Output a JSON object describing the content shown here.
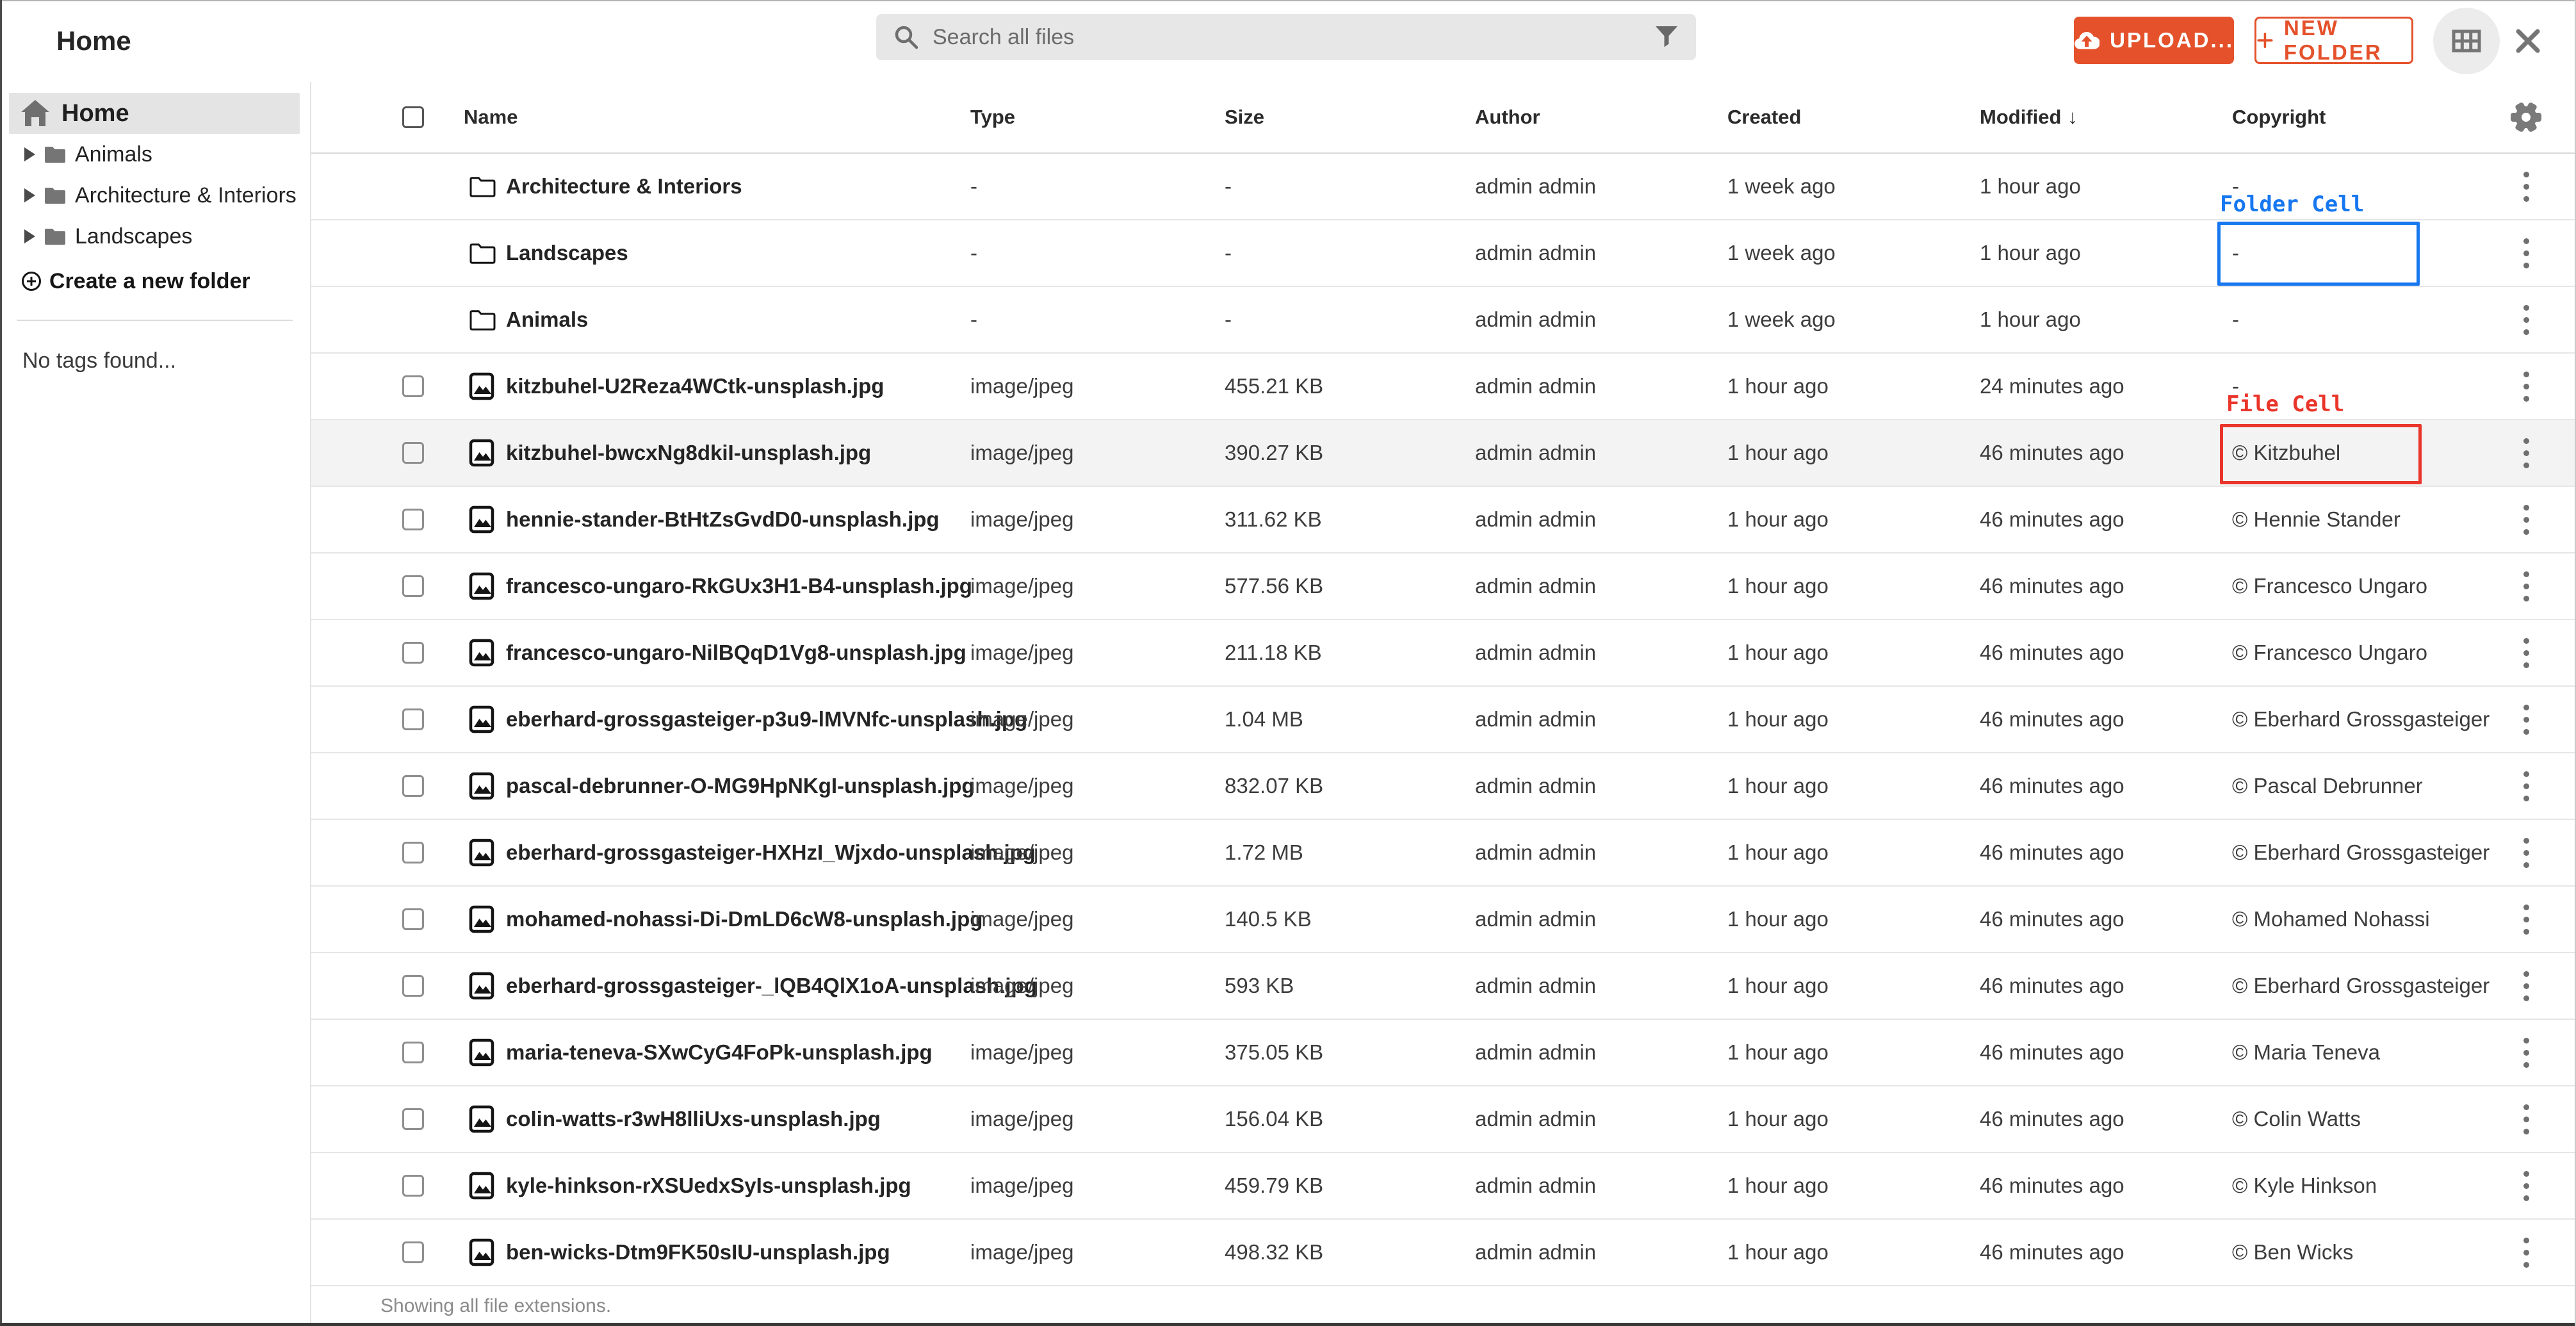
{
  "window": {
    "title": "Home"
  },
  "colors": {
    "accent_orange": "#e4512b",
    "annotation_blue": "#1677f0",
    "annotation_red": "#ea352b",
    "sidebar_selected_bg": "#e4e4e4",
    "row_highlight_bg": "#f3f3f3",
    "search_bg": "#e7e7e7"
  },
  "topbar": {
    "search_placeholder": "Search all files",
    "upload_label": "UPLOAD...",
    "new_folder_label": "NEW FOLDER",
    "icons": {
      "search": "magnifier",
      "filter": "funnel",
      "upload": "cloud-upload",
      "new_folder": "plus",
      "view_toggle": "grid",
      "close": "x"
    }
  },
  "sidebar": {
    "home_label": "Home",
    "home_icon": "house",
    "folders": [
      "Animals",
      "Architecture & Interiors",
      "Landscapes"
    ],
    "create_label": "Create a new folder",
    "create_icon": "circle-plus",
    "empty_tags": "No tags found..."
  },
  "table": {
    "headers": [
      "Name",
      "Type",
      "Size",
      "Author",
      "Created",
      "Modified",
      "Copyright"
    ],
    "sort": {
      "column": "Modified",
      "direction": "desc",
      "glyph": "↓"
    },
    "header_icons": {
      "settings": "gear",
      "select_all": "checkbox"
    },
    "row_menu_icon": "kebab",
    "rows": [
      {
        "kind": "folder",
        "name": "Architecture & Interiors",
        "type": "-",
        "size": "-",
        "author": "admin admin",
        "created": "1 week ago",
        "modified": "1 hour ago",
        "copyright": "-"
      },
      {
        "kind": "folder",
        "name": "Landscapes",
        "type": "-",
        "size": "-",
        "author": "admin admin",
        "created": "1 week ago",
        "modified": "1 hour ago",
        "copyright": "-",
        "annotation": "folder_cell"
      },
      {
        "kind": "folder",
        "name": "Animals",
        "type": "-",
        "size": "-",
        "author": "admin admin",
        "created": "1 week ago",
        "modified": "1 hour ago",
        "copyright": "-"
      },
      {
        "kind": "file",
        "name": "kitzbuhel-U2Reza4WCtk-unsplash.jpg",
        "type": "image/jpeg",
        "size": "455.21 KB",
        "author": "admin admin",
        "created": "1 hour ago",
        "modified": "24 minutes ago",
        "copyright": "-"
      },
      {
        "kind": "file",
        "name": "kitzbuhel-bwcxNg8dkiI-unsplash.jpg",
        "type": "image/jpeg",
        "size": "390.27 KB",
        "author": "admin admin",
        "created": "1 hour ago",
        "modified": "46 minutes ago",
        "copyright": "© Kitzbuhel",
        "highlighted": true,
        "annotation": "file_cell"
      },
      {
        "kind": "file",
        "name": "hennie-stander-BtHtZsGvdD0-unsplash.jpg",
        "type": "image/jpeg",
        "size": "311.62 KB",
        "author": "admin admin",
        "created": "1 hour ago",
        "modified": "46 minutes ago",
        "copyright": "© Hennie Stander"
      },
      {
        "kind": "file",
        "name": "francesco-ungaro-RkGUx3H1-B4-unsplash.jpg",
        "type": "image/jpeg",
        "size": "577.56 KB",
        "author": "admin admin",
        "created": "1 hour ago",
        "modified": "46 minutes ago",
        "copyright": "© Francesco Ungaro"
      },
      {
        "kind": "file",
        "name": "francesco-ungaro-NilBQqD1Vg8-unsplash.jpg",
        "type": "image/jpeg",
        "size": "211.18 KB",
        "author": "admin admin",
        "created": "1 hour ago",
        "modified": "46 minutes ago",
        "copyright": "© Francesco Ungaro"
      },
      {
        "kind": "file",
        "name": "eberhard-grossgasteiger-p3u9-lMVNfc-unsplash.jpg",
        "type": "image/jpeg",
        "size": "1.04 MB",
        "author": "admin admin",
        "created": "1 hour ago",
        "modified": "46 minutes ago",
        "copyright": "© Eberhard Grossgasteiger"
      },
      {
        "kind": "file",
        "name": "pascal-debrunner-O-MG9HpNKgI-unsplash.jpg",
        "type": "image/jpeg",
        "size": "832.07 KB",
        "author": "admin admin",
        "created": "1 hour ago",
        "modified": "46 minutes ago",
        "copyright": "© Pascal Debrunner"
      },
      {
        "kind": "file",
        "name": "eberhard-grossgasteiger-HXHzI_Wjxdo-unsplash.jpg",
        "type": "image/jpeg",
        "size": "1.72 MB",
        "author": "admin admin",
        "created": "1 hour ago",
        "modified": "46 minutes ago",
        "copyright": "© Eberhard Grossgasteiger"
      },
      {
        "kind": "file",
        "name": "mohamed-nohassi-Di-DmLD6cW8-unsplash.jpg",
        "type": "image/jpeg",
        "size": "140.5 KB",
        "author": "admin admin",
        "created": "1 hour ago",
        "modified": "46 minutes ago",
        "copyright": "© Mohamed Nohassi"
      },
      {
        "kind": "file",
        "name": "eberhard-grossgasteiger-_lQB4QlX1oA-unsplash.jpg",
        "type": "image/jpeg",
        "size": "593 KB",
        "author": "admin admin",
        "created": "1 hour ago",
        "modified": "46 minutes ago",
        "copyright": "© Eberhard Grossgasteiger"
      },
      {
        "kind": "file",
        "name": "maria-teneva-SXwCyG4FoPk-unsplash.jpg",
        "type": "image/jpeg",
        "size": "375.05 KB",
        "author": "admin admin",
        "created": "1 hour ago",
        "modified": "46 minutes ago",
        "copyright": "© Maria Teneva"
      },
      {
        "kind": "file",
        "name": "colin-watts-r3wH8lliUxs-unsplash.jpg",
        "type": "image/jpeg",
        "size": "156.04 KB",
        "author": "admin admin",
        "created": "1 hour ago",
        "modified": "46 minutes ago",
        "copyright": "© Colin Watts"
      },
      {
        "kind": "file",
        "name": "kyle-hinkson-rXSUedxSyIs-unsplash.jpg",
        "type": "image/jpeg",
        "size": "459.79 KB",
        "author": "admin admin",
        "created": "1 hour ago",
        "modified": "46 minutes ago",
        "copyright": "© Kyle Hinkson"
      },
      {
        "kind": "file",
        "name": "ben-wicks-Dtm9FK50sIU-unsplash.jpg",
        "type": "image/jpeg",
        "size": "498.32 KB",
        "author": "admin admin",
        "created": "1 hour ago",
        "modified": "46 minutes ago",
        "copyright": "© Ben Wicks"
      }
    ]
  },
  "annotations": {
    "folder_cell_label": "Folder Cell",
    "file_cell_label": "File Cell"
  },
  "statusbar": {
    "text": "Showing all file extensions."
  }
}
